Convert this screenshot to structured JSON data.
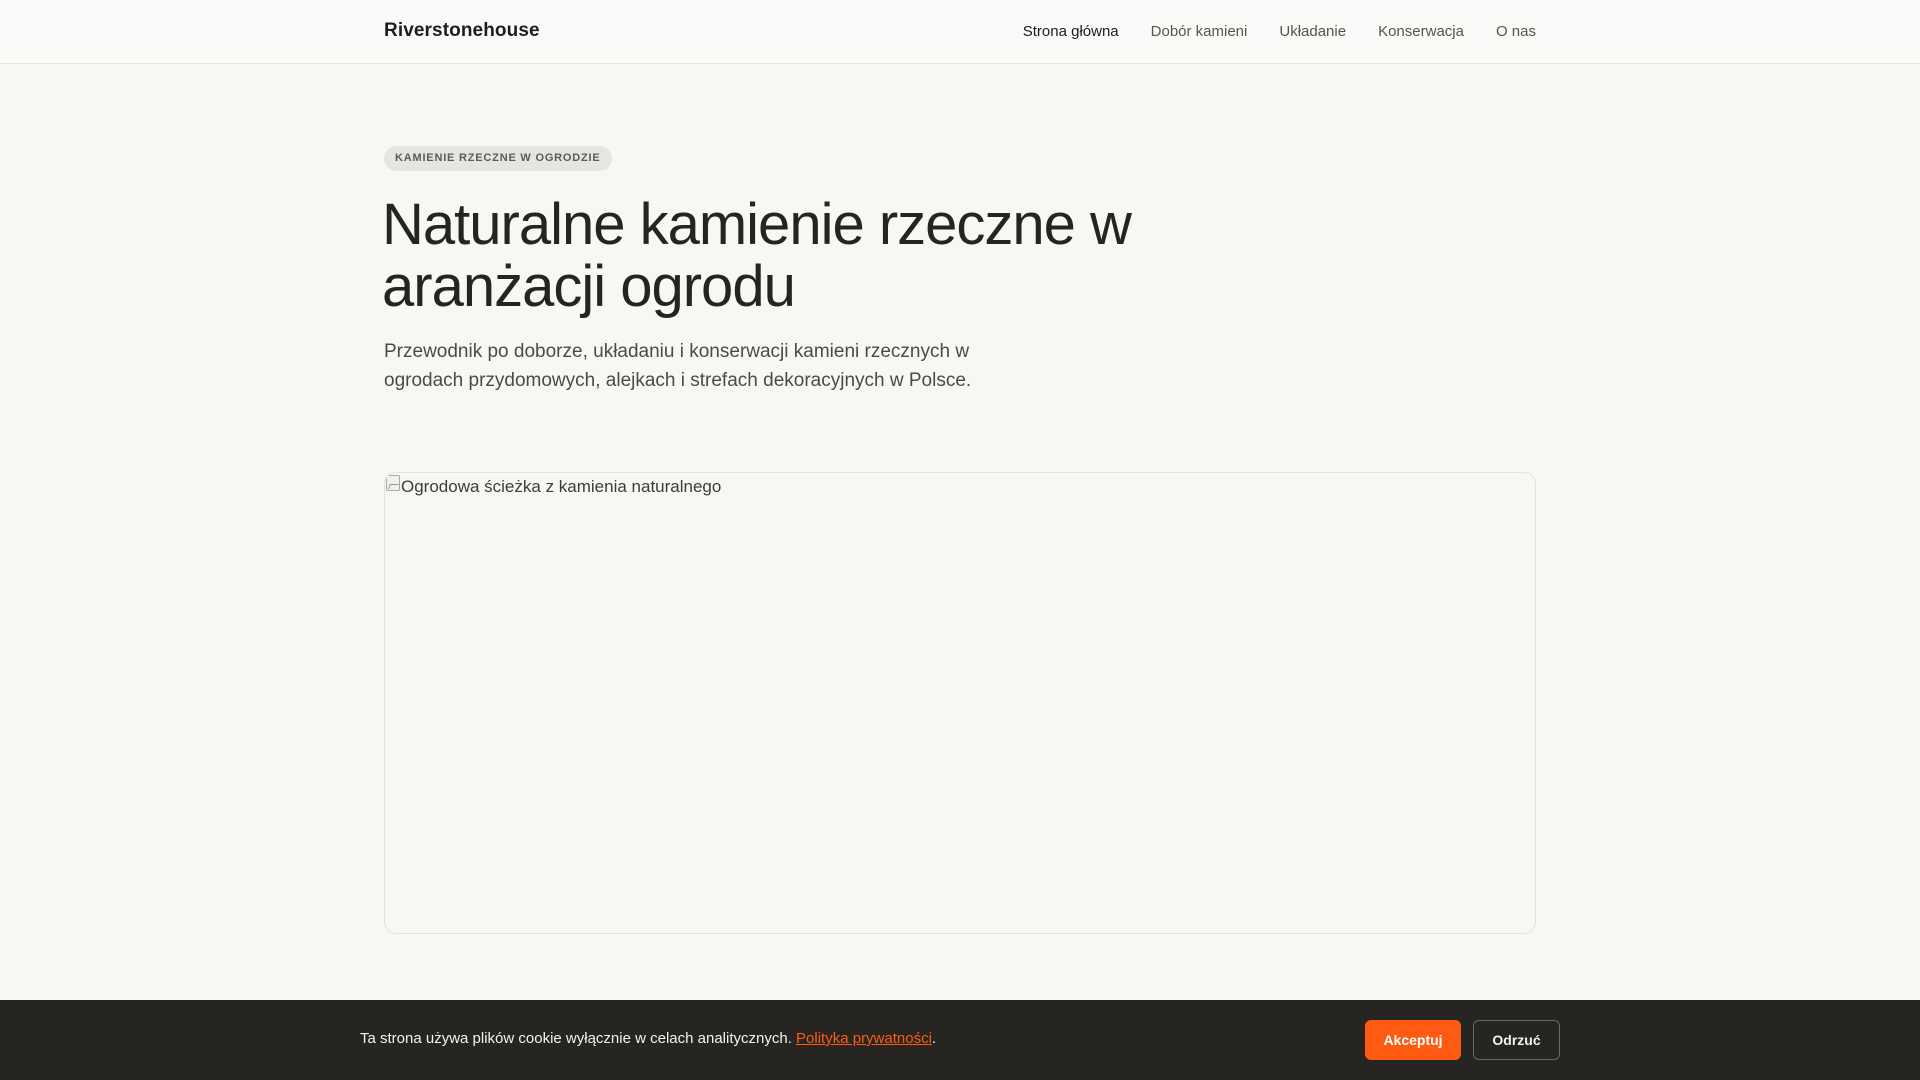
{
  "header": {
    "brand": "Riverstonehouse",
    "nav": [
      {
        "label": "Strona główna",
        "active": true
      },
      {
        "label": "Dobór kamieni",
        "active": false
      },
      {
        "label": "Układanie",
        "active": false
      },
      {
        "label": "Konserwacja",
        "active": false
      },
      {
        "label": "O nas",
        "active": false
      }
    ]
  },
  "hero": {
    "eyebrow": "KAMIENIE RZECZNE W OGRODZIE",
    "title": "Naturalne kamienie rzeczne w aranżacji ogrodu",
    "lead": "Przewodnik po doborze, układaniu i konserwacji kamieni rzecznych w ogrodach przydomowych, alejkach i strefach dekoracyjnych w Polsce.",
    "image_alt": "Ogrodowa ścieżka z kamienia naturalnego"
  },
  "cookie": {
    "text": "Ta strona używa plików cookie wyłącznie w celach analitycznych.",
    "link": "Polityka prywatności",
    "suffix": ".",
    "accept": "Akceptuj",
    "decline": "Odrzuć"
  },
  "colors": {
    "accent": "#ff5a12",
    "cookie_bg": "#262522",
    "page_bg": "#f7f7f4"
  }
}
